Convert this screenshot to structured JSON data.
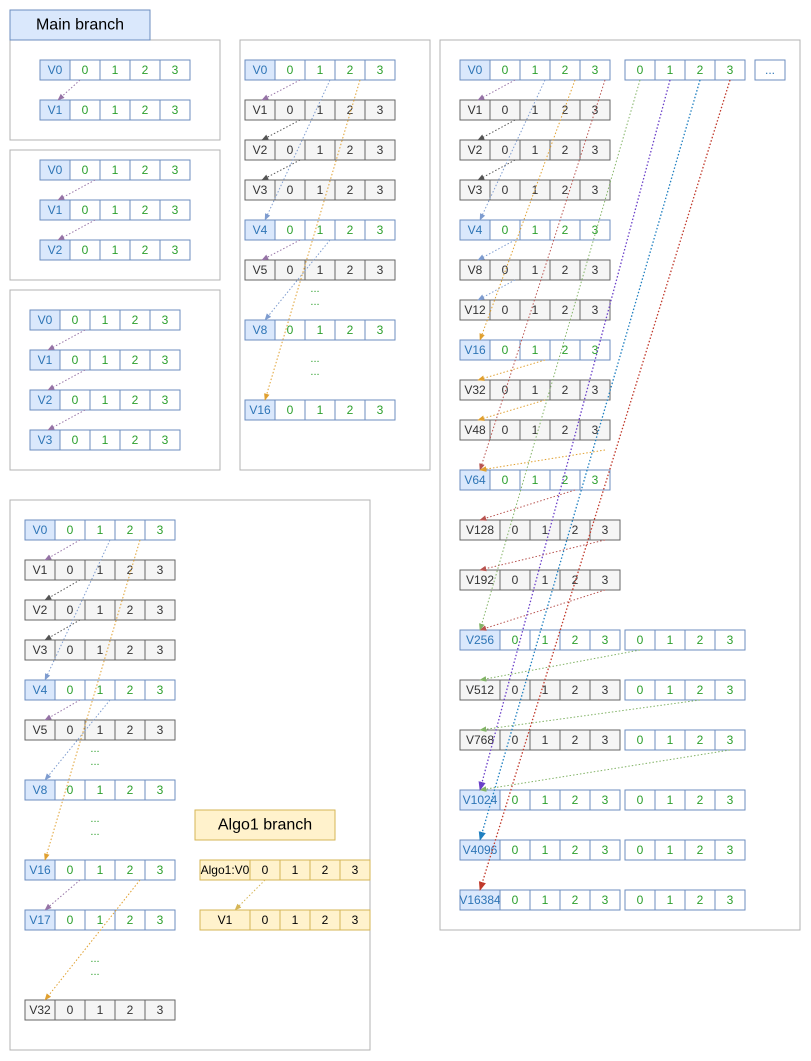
{
  "titles": {
    "main_branch": "Main branch",
    "algo1_branch": "Algo1 branch"
  },
  "colors": {
    "blue_fill": "#dae8fc",
    "blue_stroke": "#6c8ebf",
    "blue_text": "#2e75b6",
    "gray_fill": "#f5f5f5",
    "gray_stroke": "#666666",
    "gray_text": "#333333",
    "yellow_fill": "#fff2cc",
    "yellow_stroke": "#d6b656",
    "green_text": "#2ca02c",
    "purple": "#9673a6",
    "dark_gray": "#555555",
    "light_blue": "#7e9ccf",
    "orange": "#e0a030",
    "red": "#b85450",
    "olive_green": "#82b366",
    "violet": "#6a3fc8",
    "teal_blue": "#1f7fc0",
    "bright_red": "#c0392b"
  },
  "cell_values": [
    "0",
    "1",
    "2",
    "3"
  ],
  "ellipsis_box": "...",
  "dots": "...",
  "versions": {
    "v0": "V0",
    "v1": "V1",
    "v2": "V2",
    "v3": "V3",
    "v4": "V4",
    "v5": "V5",
    "v8": "V8",
    "v12": "V12",
    "v16": "V16",
    "v17": "V17",
    "v32": "V32",
    "v48": "V48",
    "v64": "V64",
    "v128": "V128",
    "v192": "V192",
    "v256": "V256",
    "v512": "V512",
    "v768": "V768",
    "v1024": "V1024",
    "v4096": "V4096",
    "v16384": "V16384",
    "algo1_v0": "Algo1:V0"
  }
}
